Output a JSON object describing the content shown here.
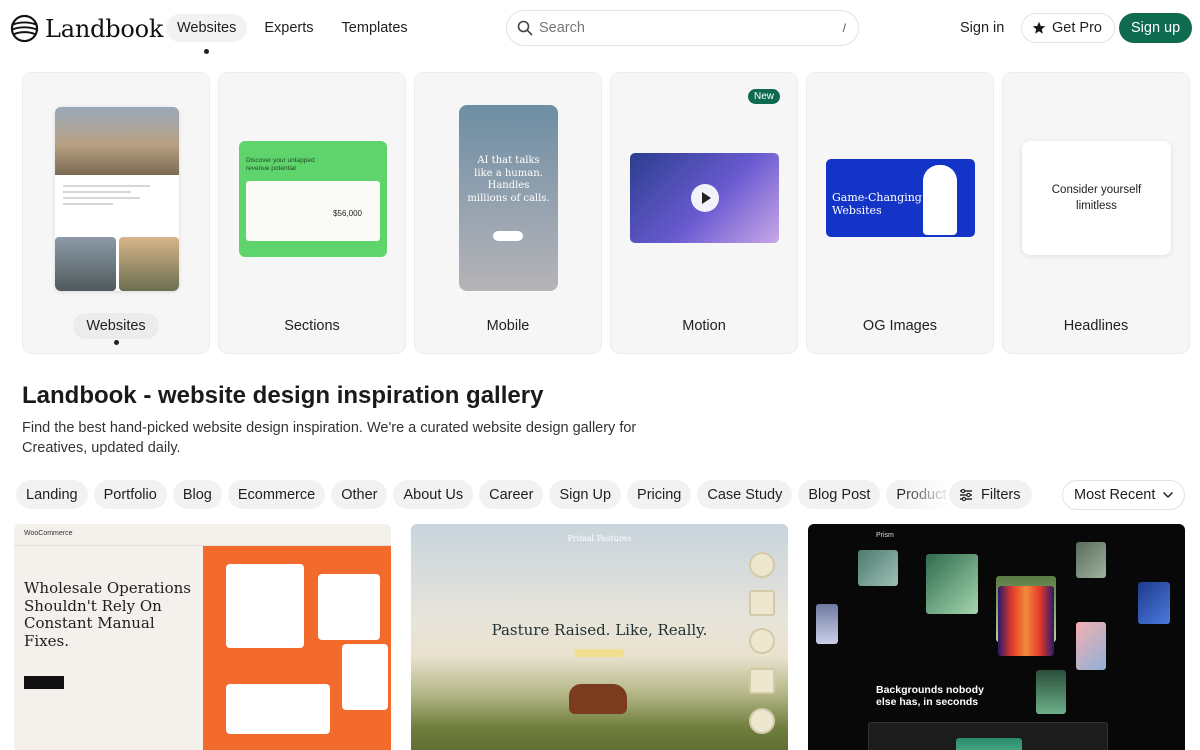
{
  "header": {
    "logo_text": "Landbook",
    "nav": [
      {
        "label": "Websites",
        "active": true
      },
      {
        "label": "Experts",
        "active": false
      },
      {
        "label": "Templates",
        "active": false
      }
    ],
    "search": {
      "placeholder": "Search",
      "shortcut": "/"
    },
    "sign_in": "Sign in",
    "get_pro": "Get Pro",
    "sign_up": "Sign up",
    "accent_color": "#0f6b4f"
  },
  "categories": [
    {
      "label": "Websites",
      "active": true,
      "badge": ""
    },
    {
      "label": "Sections",
      "active": false,
      "badge": ""
    },
    {
      "label": "Mobile",
      "active": false,
      "badge": ""
    },
    {
      "label": "Motion",
      "active": false,
      "badge": "New"
    },
    {
      "label": "OG Images",
      "active": false,
      "badge": ""
    },
    {
      "label": "Headlines",
      "active": false,
      "badge": ""
    }
  ],
  "previews": {
    "sections_title": "Discover your untapped revenue potential",
    "sections_amount": "$56,000",
    "mobile_text": "AI that talks like a human. Handles millions of calls.",
    "og_text": "Game-Changing Websites",
    "headline_text": "Consider yourself limitless"
  },
  "intro": {
    "title": "Landbook - website design inspiration gallery",
    "description": "Find the best hand-picked website design inspiration. We're a curated website design gallery for Creatives, updated daily."
  },
  "filters": {
    "chips": [
      "Landing",
      "Portfolio",
      "Blog",
      "Ecommerce",
      "Other",
      "About Us",
      "Career",
      "Sign Up",
      "Pricing",
      "Case Study",
      "Blog Post",
      "Product"
    ],
    "filters_label": "Filters",
    "sort_label": "Most Recent"
  },
  "gallery": [
    {
      "headline": "Wholesale Operations Shouldn't Rely On Constant Manual Fixes.",
      "brand": "WooCommerce"
    },
    {
      "headline": "Pasture Raised. Like, Really.",
      "brand": "Primal Pastures"
    },
    {
      "headline": "Backgrounds nobody else has, in seconds",
      "brand": "Prism"
    }
  ]
}
